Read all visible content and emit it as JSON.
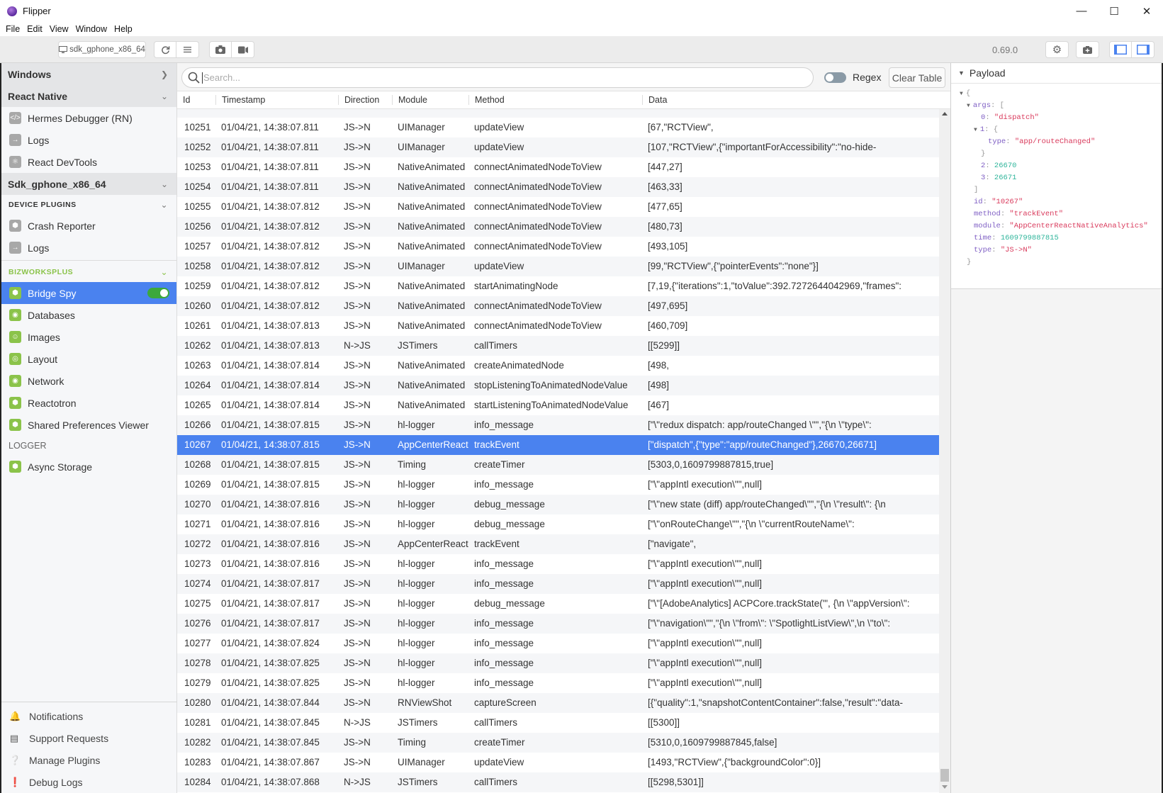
{
  "window": {
    "title": "Flipper",
    "controls": [
      "minimize-icon",
      "maximize-icon",
      "close-icon"
    ]
  },
  "menu": [
    "File",
    "Edit",
    "View",
    "Window",
    "Help"
  ],
  "toolbar": {
    "device": "sdk_gphone_x86_64",
    "version": "0.69.0",
    "icons": [
      "monitor-icon",
      "refresh-icon",
      "menu-icon",
      "camera-icon",
      "video-icon",
      "gear-icon",
      "rescue-icon",
      "left-sidebar-toggle-icon",
      "right-sidebar-toggle-icon"
    ]
  },
  "sidebar": {
    "windows": "Windows",
    "react_native": {
      "title": "React Native",
      "items": [
        {
          "label": "Hermes Debugger (RN)",
          "icon": "code-icon"
        },
        {
          "label": "Logs",
          "icon": "arrow-right-icon"
        },
        {
          "label": "React DevTools",
          "icon": "react-atom-icon"
        }
      ]
    },
    "device": {
      "title": "Sdk_gphone_x86_64",
      "device_plugins_label": "DEVICE PLUGINS",
      "device_plugins": [
        {
          "label": "Crash Reporter",
          "icon": "box-icon"
        },
        {
          "label": "Logs",
          "icon": "arrow-right-icon"
        }
      ],
      "bizworksplus_label": "BIZWORKSPLUS",
      "bizworksplus": [
        {
          "label": "Bridge Spy",
          "icon": "box-icon",
          "active": true,
          "enabled": true
        },
        {
          "label": "Databases",
          "icon": "globe-icon"
        },
        {
          "label": "Images",
          "icon": "person-icon"
        },
        {
          "label": "Layout",
          "icon": "target-icon"
        },
        {
          "label": "Network",
          "icon": "globe-icon"
        },
        {
          "label": "Reactotron",
          "icon": "box-icon"
        },
        {
          "label": "Shared Preferences Viewer",
          "icon": "box-icon"
        }
      ],
      "logger_label": "LOGGER",
      "logger": [
        {
          "label": "Async Storage",
          "icon": "box-icon"
        }
      ]
    },
    "bottom": [
      {
        "label": "Notifications",
        "icon": "bell-icon"
      },
      {
        "label": "Support Requests",
        "icon": "support-icon"
      },
      {
        "label": "Manage Plugins",
        "icon": "question-icon"
      },
      {
        "label": "Debug Logs",
        "icon": "exclamation-icon"
      }
    ]
  },
  "search": {
    "placeholder": "Search...",
    "value": "",
    "regex_label": "Regex",
    "regex_enabled": false,
    "clear_label": "Clear Table"
  },
  "table": {
    "columns": [
      "Id",
      "Timestamp",
      "Direction",
      "Module",
      "Method",
      "Data"
    ],
    "selected_id": "10267",
    "rows": [
      [
        "10251",
        "01/04/21, 14:38:07.811",
        "JS->N",
        "UIManager",
        "updateView",
        "[67,\"RCTView\","
      ],
      [
        "10252",
        "01/04/21, 14:38:07.811",
        "JS->N",
        "UIManager",
        "updateView",
        "[107,\"RCTView\",{\"importantForAccessibility\":\"no-hide-"
      ],
      [
        "10253",
        "01/04/21, 14:38:07.811",
        "JS->N",
        "NativeAnimated",
        "connectAnimatedNodeToView",
        "[447,27]"
      ],
      [
        "10254",
        "01/04/21, 14:38:07.811",
        "JS->N",
        "NativeAnimated",
        "connectAnimatedNodeToView",
        "[463,33]"
      ],
      [
        "10255",
        "01/04/21, 14:38:07.812",
        "JS->N",
        "NativeAnimated",
        "connectAnimatedNodeToView",
        "[477,65]"
      ],
      [
        "10256",
        "01/04/21, 14:38:07.812",
        "JS->N",
        "NativeAnimated",
        "connectAnimatedNodeToView",
        "[480,73]"
      ],
      [
        "10257",
        "01/04/21, 14:38:07.812",
        "JS->N",
        "NativeAnimated",
        "connectAnimatedNodeToView",
        "[493,105]"
      ],
      [
        "10258",
        "01/04/21, 14:38:07.812",
        "JS->N",
        "UIManager",
        "updateView",
        "[99,\"RCTView\",{\"pointerEvents\":\"none\"}]"
      ],
      [
        "10259",
        "01/04/21, 14:38:07.812",
        "JS->N",
        "NativeAnimated",
        "startAnimatingNode",
        "[7,19,{\"iterations\":1,\"toValue\":392.7272644042969,\"frames\":"
      ],
      [
        "10260",
        "01/04/21, 14:38:07.812",
        "JS->N",
        "NativeAnimated",
        "connectAnimatedNodeToView",
        "[497,695]"
      ],
      [
        "10261",
        "01/04/21, 14:38:07.813",
        "JS->N",
        "NativeAnimated",
        "connectAnimatedNodeToView",
        "[460,709]"
      ],
      [
        "10262",
        "01/04/21, 14:38:07.813",
        "N->JS",
        "JSTimers",
        "callTimers",
        "[[5299]]"
      ],
      [
        "10263",
        "01/04/21, 14:38:07.814",
        "JS->N",
        "NativeAnimated",
        "createAnimatedNode",
        "[498,"
      ],
      [
        "10264",
        "01/04/21, 14:38:07.814",
        "JS->N",
        "NativeAnimated",
        "stopListeningToAnimatedNodeValue",
        "[498]"
      ],
      [
        "10265",
        "01/04/21, 14:38:07.814",
        "JS->N",
        "NativeAnimated",
        "startListeningToAnimatedNodeValue",
        "[467]"
      ],
      [
        "10266",
        "01/04/21, 14:38:07.815",
        "JS->N",
        "hl-logger",
        "info_message",
        "[\"\\\"redux dispatch: app/routeChanged \\\"\",\"{\\n \\\"type\\\":"
      ],
      [
        "10267",
        "01/04/21, 14:38:07.815",
        "JS->N",
        "AppCenterReact",
        "trackEvent",
        "[\"dispatch\",{\"type\":\"app/routeChanged\"},26670,26671]"
      ],
      [
        "10268",
        "01/04/21, 14:38:07.815",
        "JS->N",
        "Timing",
        "createTimer",
        "[5303,0,1609799887815,true]"
      ],
      [
        "10269",
        "01/04/21, 14:38:07.815",
        "JS->N",
        "hl-logger",
        "info_message",
        "[\"\\\"appIntl execution\\\"\",null]"
      ],
      [
        "10270",
        "01/04/21, 14:38:07.816",
        "JS->N",
        "hl-logger",
        "debug_message",
        "[\"\\\"new state (diff) app/routeChanged\\\"\",\"{\\n \\\"result\\\": {\\n"
      ],
      [
        "10271",
        "01/04/21, 14:38:07.816",
        "JS->N",
        "hl-logger",
        "debug_message",
        "[\"\\\"onRouteChange\\\"\",\"{\\n \\\"currentRouteName\\\":"
      ],
      [
        "10272",
        "01/04/21, 14:38:07.816",
        "JS->N",
        "AppCenterReact",
        "trackEvent",
        "[\"navigate\","
      ],
      [
        "10273",
        "01/04/21, 14:38:07.816",
        "JS->N",
        "hl-logger",
        "info_message",
        "[\"\\\"appIntl execution\\\"\",null]"
      ],
      [
        "10274",
        "01/04/21, 14:38:07.817",
        "JS->N",
        "hl-logger",
        "info_message",
        "[\"\\\"appIntl execution\\\"\",null]"
      ],
      [
        "10275",
        "01/04/21, 14:38:07.817",
        "JS->N",
        "hl-logger",
        "debug_message",
        "[\"\\\"[AdobeAnalytics] ACPCore.trackState('\", {\\n \\\"appVersion\\\":"
      ],
      [
        "10276",
        "01/04/21, 14:38:07.817",
        "JS->N",
        "hl-logger",
        "info_message",
        "[\"\\\"navigation\\\"\",\"{\\n \\\"from\\\": \\\"SpotlightListView\\\",\\n \\\"to\\\":"
      ],
      [
        "10277",
        "01/04/21, 14:38:07.824",
        "JS->N",
        "hl-logger",
        "info_message",
        "[\"\\\"appIntl execution\\\"\",null]"
      ],
      [
        "10278",
        "01/04/21, 14:38:07.825",
        "JS->N",
        "hl-logger",
        "info_message",
        "[\"\\\"appIntl execution\\\"\",null]"
      ],
      [
        "10279",
        "01/04/21, 14:38:07.825",
        "JS->N",
        "hl-logger",
        "info_message",
        "[\"\\\"appIntl execution\\\"\",null]"
      ],
      [
        "10280",
        "01/04/21, 14:38:07.844",
        "JS->N",
        "RNViewShot",
        "captureScreen",
        "[{\"quality\":1,\"snapshotContentContainer\":false,\"result\":\"data-"
      ],
      [
        "10281",
        "01/04/21, 14:38:07.845",
        "N->JS",
        "JSTimers",
        "callTimers",
        "[[5300]]"
      ],
      [
        "10282",
        "01/04/21, 14:38:07.845",
        "JS->N",
        "Timing",
        "createTimer",
        "[5310,0,1609799887845,false]"
      ],
      [
        "10283",
        "01/04/21, 14:38:07.867",
        "JS->N",
        "UIManager",
        "updateView",
        "[1493,\"RCTView\",{\"backgroundColor\":0}]"
      ],
      [
        "10284",
        "01/04/21, 14:38:07.868",
        "N->JS",
        "JSTimers",
        "callTimers",
        "[[5298,5301]]"
      ]
    ]
  },
  "payload": {
    "title": "Payload",
    "lines": [
      {
        "indent": 0,
        "toggle": true,
        "key": "",
        "open": "{"
      },
      {
        "indent": 1,
        "toggle": true,
        "key": "args",
        "open": "["
      },
      {
        "indent": 2,
        "key": "0",
        "value": "\"dispatch\"",
        "type": "string"
      },
      {
        "indent": 2,
        "toggle": true,
        "key": "1",
        "open": "{"
      },
      {
        "indent": 3,
        "key": "type",
        "value": "\"app/routeChanged\"",
        "type": "string"
      },
      {
        "indent": 2,
        "close": "}"
      },
      {
        "indent": 2,
        "key": "2",
        "value": "26670",
        "type": "number"
      },
      {
        "indent": 2,
        "key": "3",
        "value": "26671",
        "type": "number"
      },
      {
        "indent": 1,
        "close": "]"
      },
      {
        "indent": 1,
        "key": "id",
        "value": "\"10267\"",
        "type": "string"
      },
      {
        "indent": 1,
        "key": "method",
        "value": "\"trackEvent\"",
        "type": "string"
      },
      {
        "indent": 1,
        "key": "module",
        "value": "\"AppCenterReactNativeAnalytics\"",
        "type": "string"
      },
      {
        "indent": 1,
        "key": "time",
        "value": "1609799887815",
        "type": "number"
      },
      {
        "indent": 1,
        "key": "type",
        "value": "\"JS->N\"",
        "type": "string"
      },
      {
        "indent": 0,
        "close": "}"
      }
    ]
  },
  "colors": {
    "accent": "#4a82ef",
    "plugin_green": "#8bc34a",
    "toggle_on": "#3ca83c",
    "json_key": "#7f5fc4",
    "json_string": "#d9395b",
    "json_number": "#2fb59b"
  }
}
